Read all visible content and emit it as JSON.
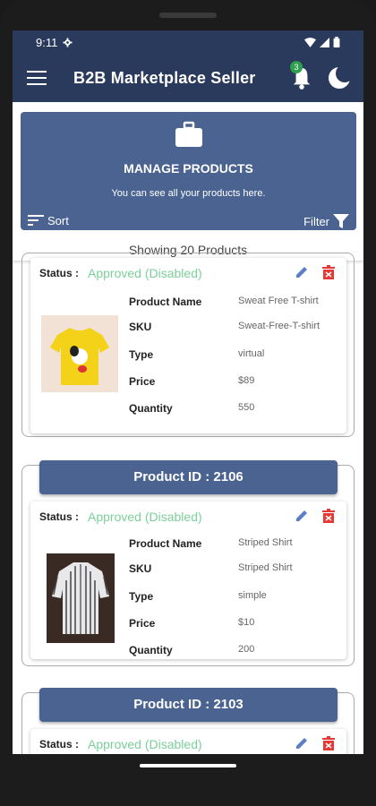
{
  "status_bar": {
    "time": "9:11"
  },
  "app_bar": {
    "title": "B2B Marketplace Seller",
    "notification_count": "3"
  },
  "banner": {
    "title": "MANAGE PRODUCTS",
    "subtitle": "You can see all your products here.",
    "sort_label": "Sort",
    "filter_label": "Filter"
  },
  "showing": "Showing 20 Products",
  "labels": {
    "status": "Status :",
    "product_name": "Product Name",
    "sku": "SKU",
    "type": "Type",
    "price": "Price",
    "quantity": "Quantity"
  },
  "products": [
    {
      "status": "Approved (Disabled)",
      "name": "Sweat Free T-shirt",
      "sku": "Sweat-Free-T-shirt",
      "type": "virtual",
      "price": "$89",
      "quantity": "550"
    },
    {
      "product_id": "Product ID : 2106",
      "status": "Approved (Disabled)",
      "name": "Striped Shirt",
      "sku": "Striped Shirt",
      "type": "simple",
      "price": "$10",
      "quantity": "200"
    },
    {
      "product_id": "Product ID : 2103",
      "status": "Approved (Disabled)"
    }
  ],
  "colors": {
    "primary": "#2a3a5c",
    "banner": "#4b6391",
    "approved": "#7bcf9a",
    "delete": "#e53935",
    "edit": "#5b7fc4"
  }
}
